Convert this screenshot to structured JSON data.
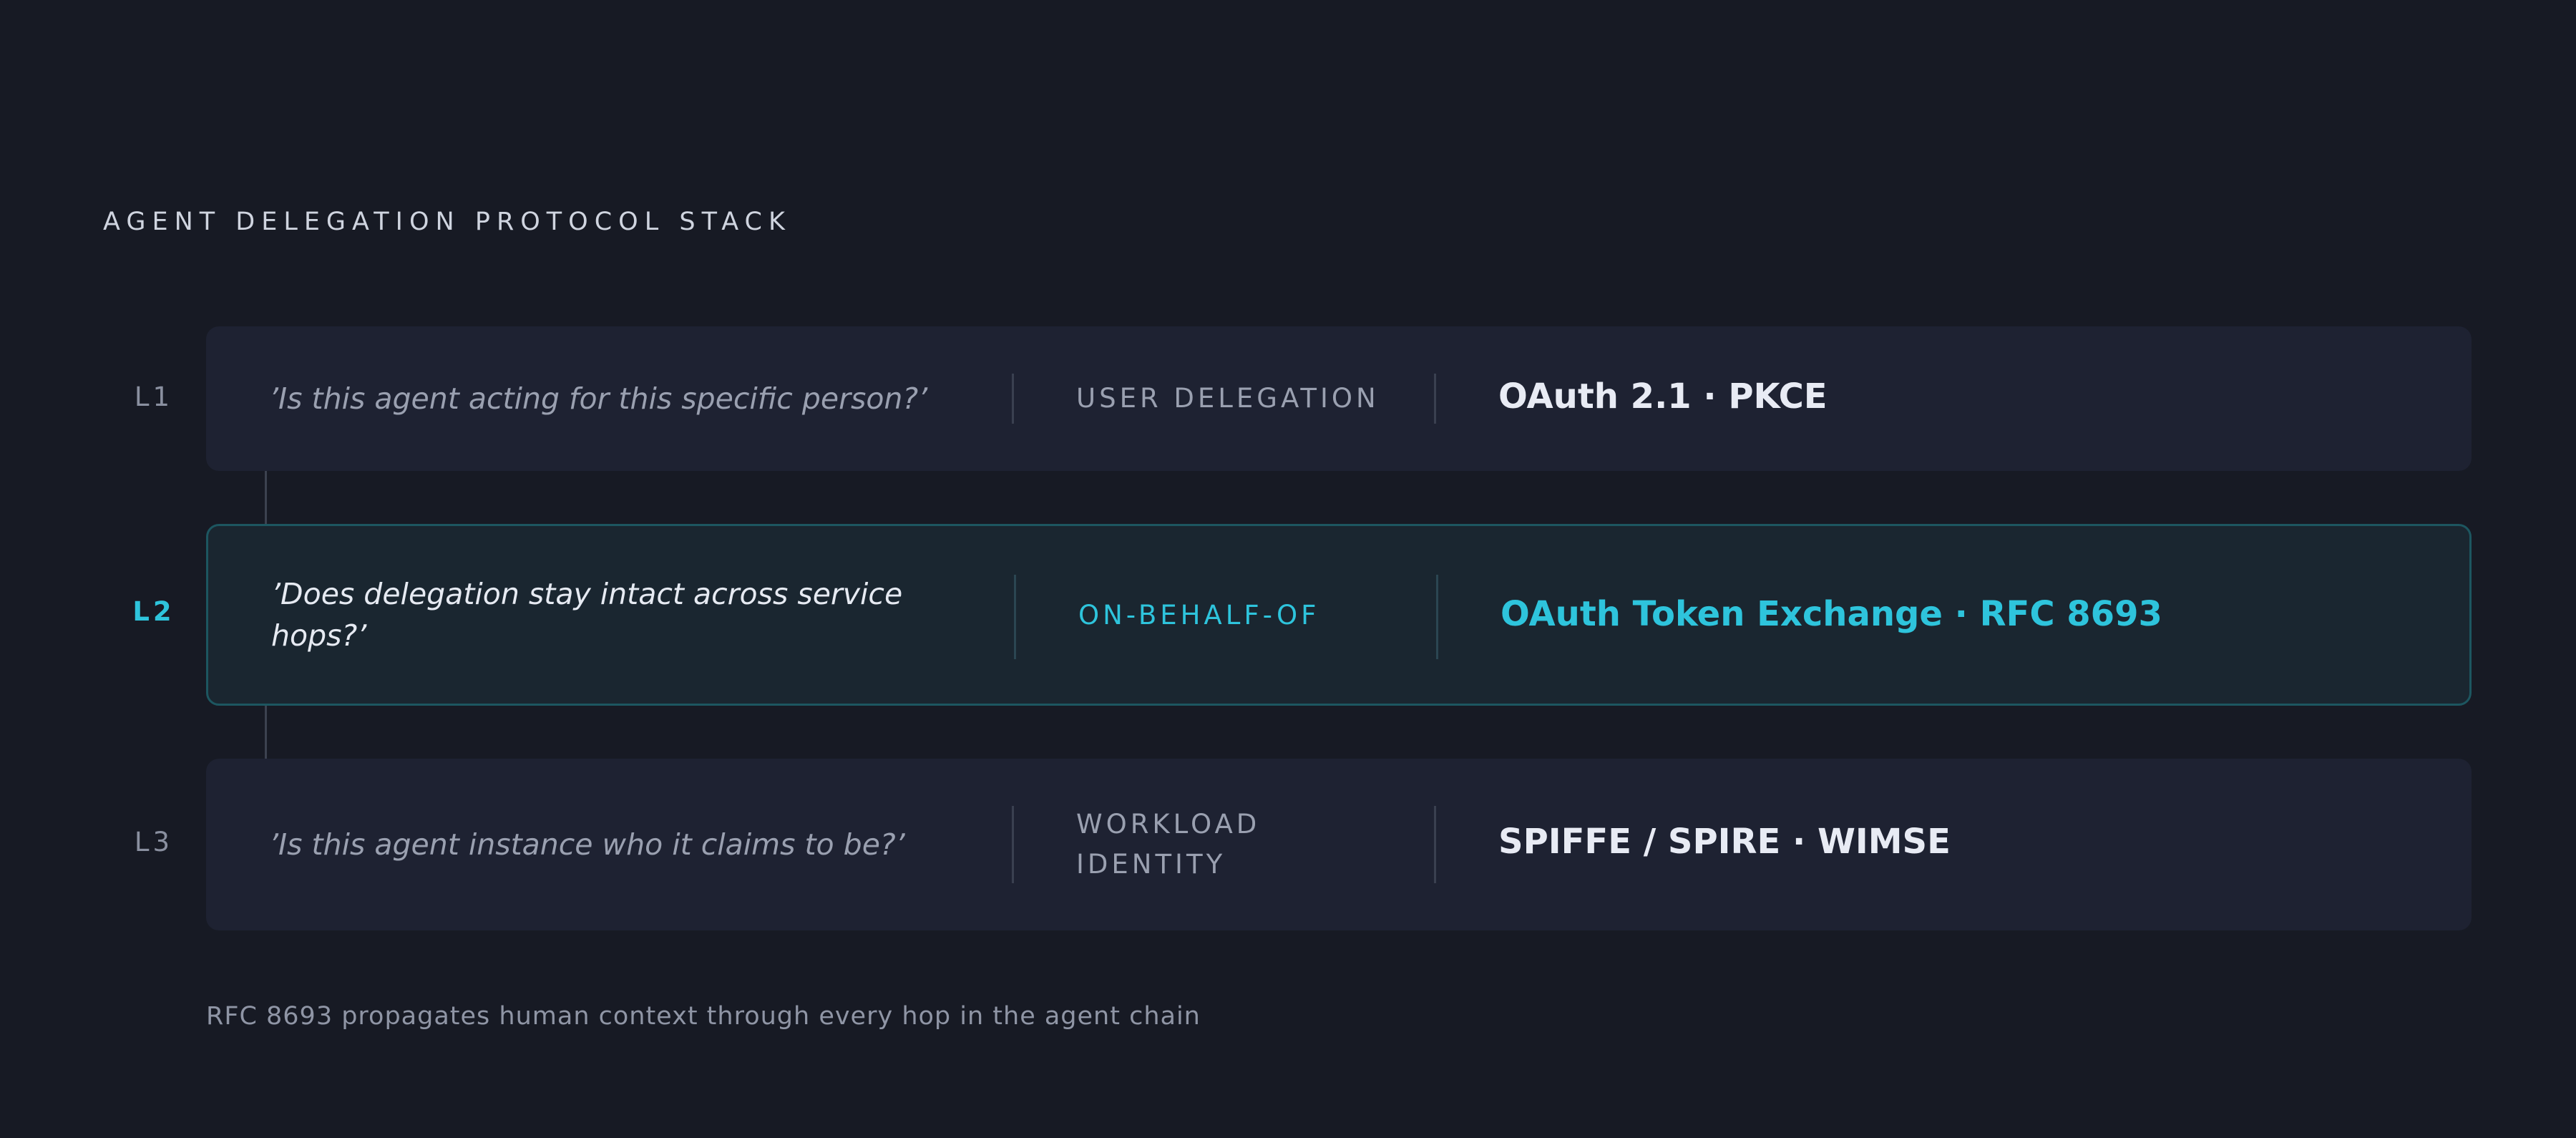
{
  "title": "AGENT DELEGATION PROTOCOL STACK",
  "layers": [
    {
      "label": "L1",
      "question": "’Is this agent acting for this specific person?’",
      "category": "USER DELEGATION",
      "protocol": "OAuth 2.1 · PKCE",
      "highlighted": false
    },
    {
      "label": "L2",
      "question": "’Does delegation stay intact across service hops?’",
      "category": "ON-BEHALF-OF",
      "protocol": "OAuth Token Exchange · RFC 8693",
      "highlighted": true
    },
    {
      "label": "L3",
      "question": "’Is this agent instance who it claims to be?’",
      "category": "WORKLOAD IDENTITY",
      "protocol": "SPIFFE / SPIRE · WIMSE",
      "highlighted": false
    }
  ],
  "footnote": "RFC 8693 propagates human context through every hop in the agent chain",
  "colors": {
    "background": "#171a24",
    "card": "#1e2232",
    "highlight_card": "#1a2630",
    "highlight_border": "#1d5660",
    "accent": "#2ec4dc",
    "muted_text": "#9aa0b0"
  }
}
